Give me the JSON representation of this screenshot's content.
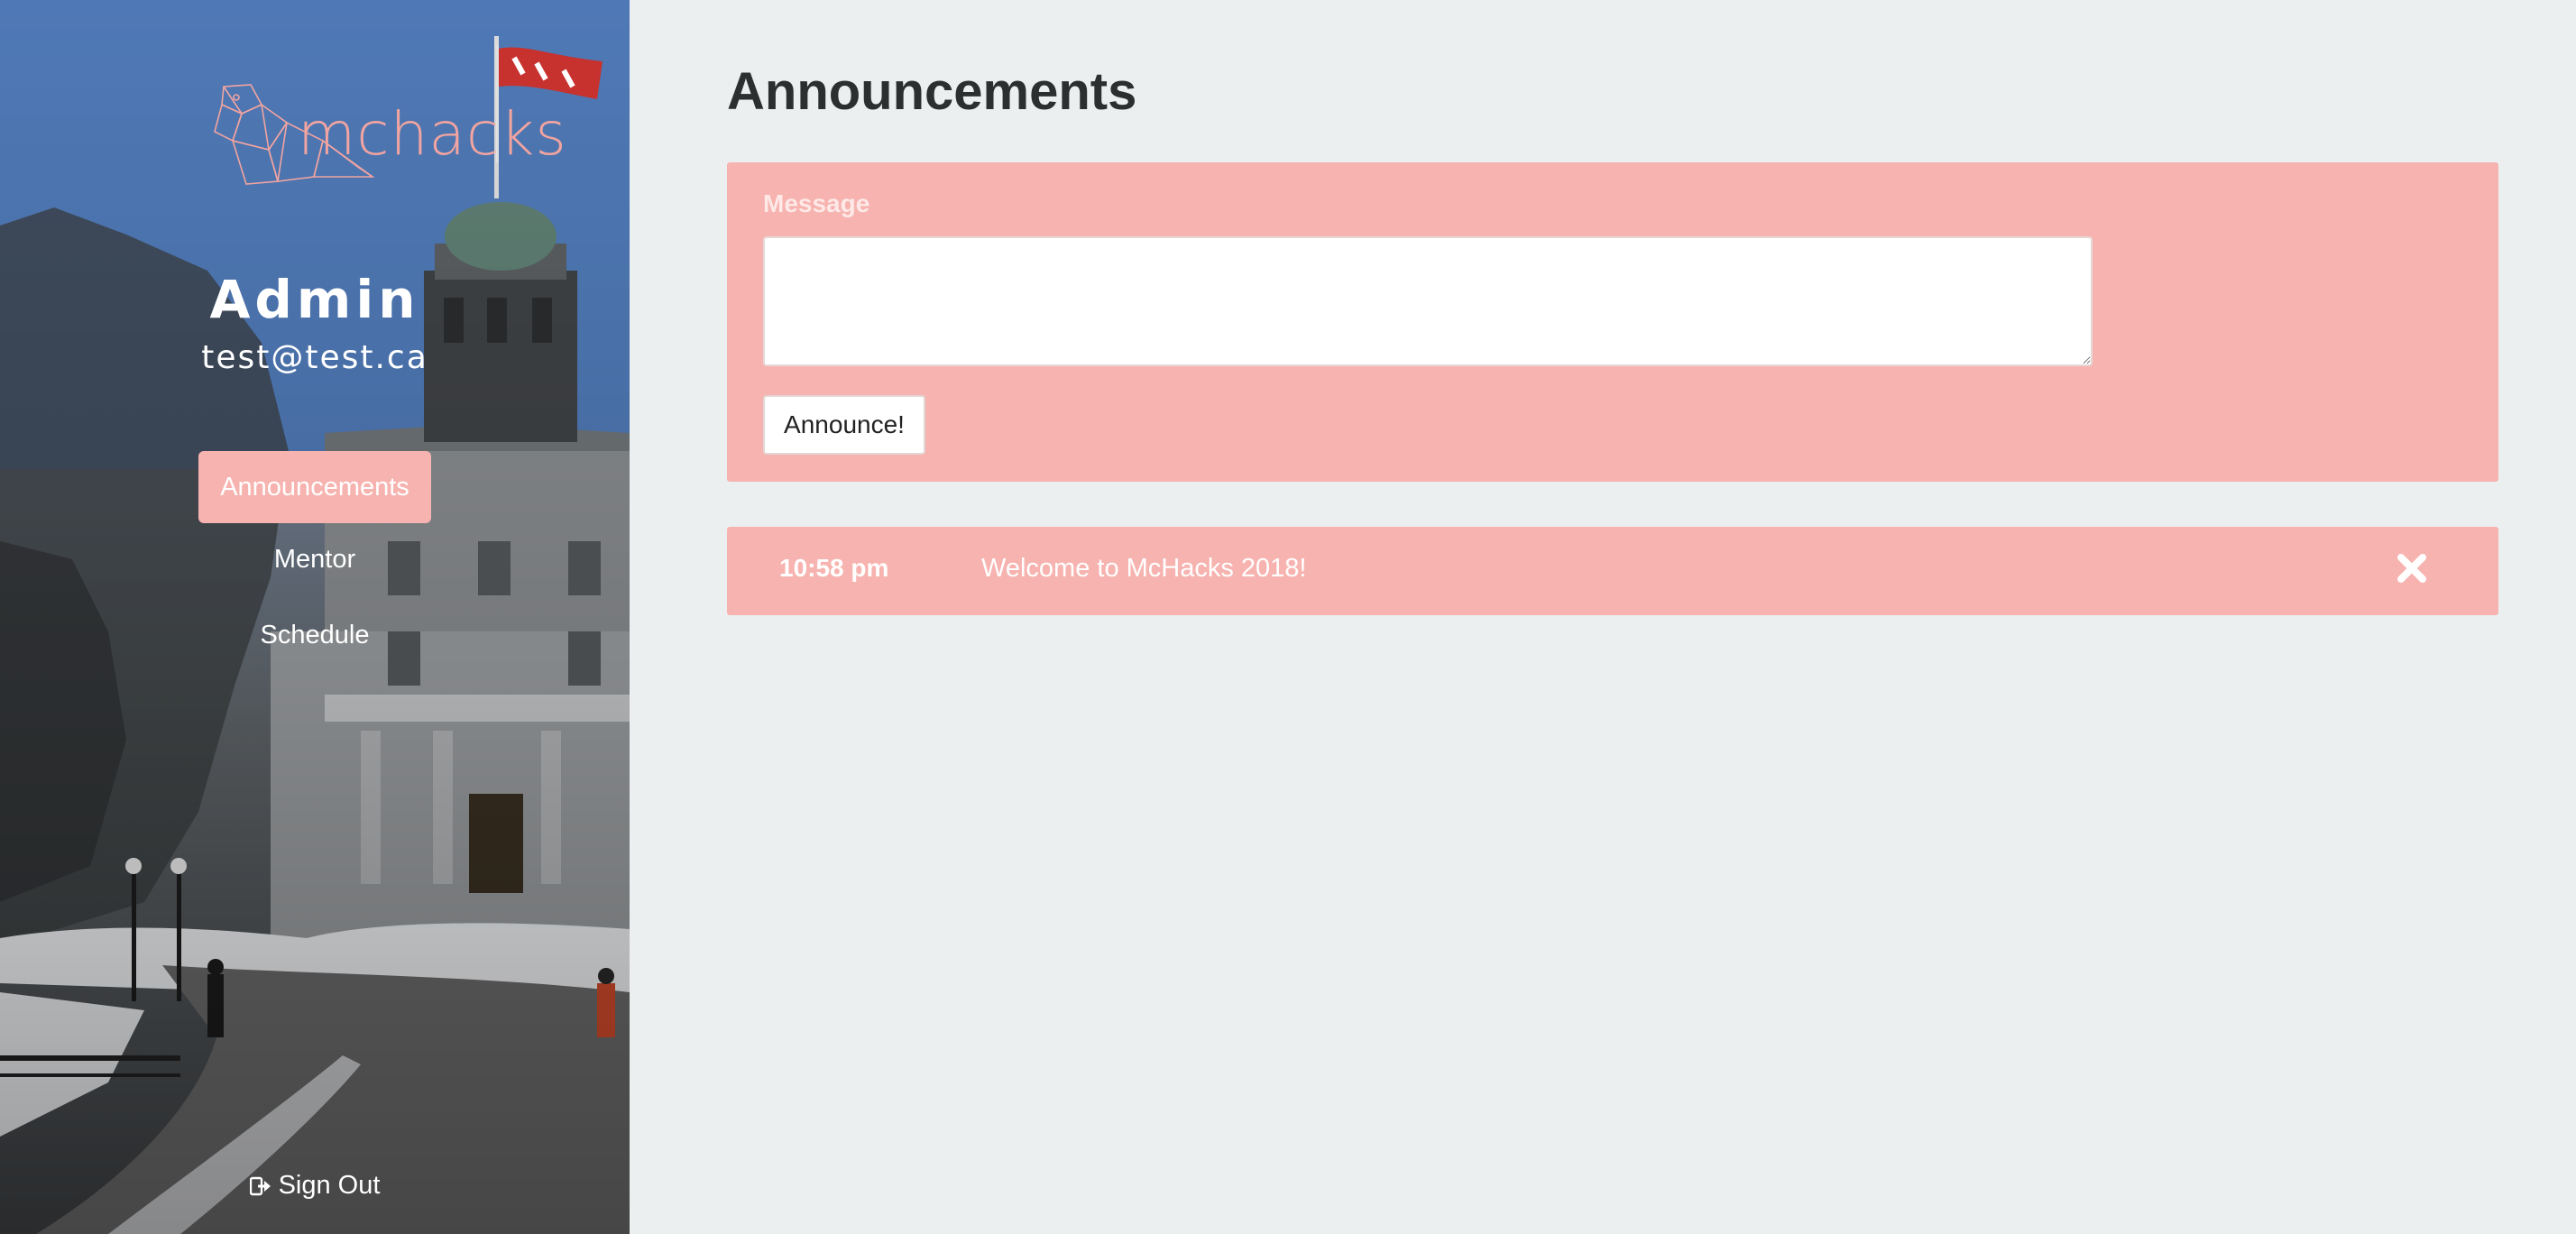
{
  "brand": {
    "logo_text": "mchacks"
  },
  "user": {
    "name": "Admin",
    "email": "test@test.ca"
  },
  "nav": {
    "items": [
      {
        "label": "Announcements",
        "active": true
      },
      {
        "label": "Mentor",
        "active": false
      },
      {
        "label": "Schedule",
        "active": false
      }
    ],
    "sign_out": "Sign Out"
  },
  "main": {
    "title": "Announcements",
    "form": {
      "label": "Message",
      "message_value": "",
      "submit_label": "Announce!"
    },
    "announcements": [
      {
        "time": "10:58 pm",
        "text": "Welcome to McHacks 2018!"
      }
    ]
  },
  "colors": {
    "accent": "#f7b3af",
    "background": "#eceff0",
    "title": "#2c2f30"
  },
  "icons": {
    "sign_out": "sign-out-icon",
    "delete": "close-icon"
  }
}
